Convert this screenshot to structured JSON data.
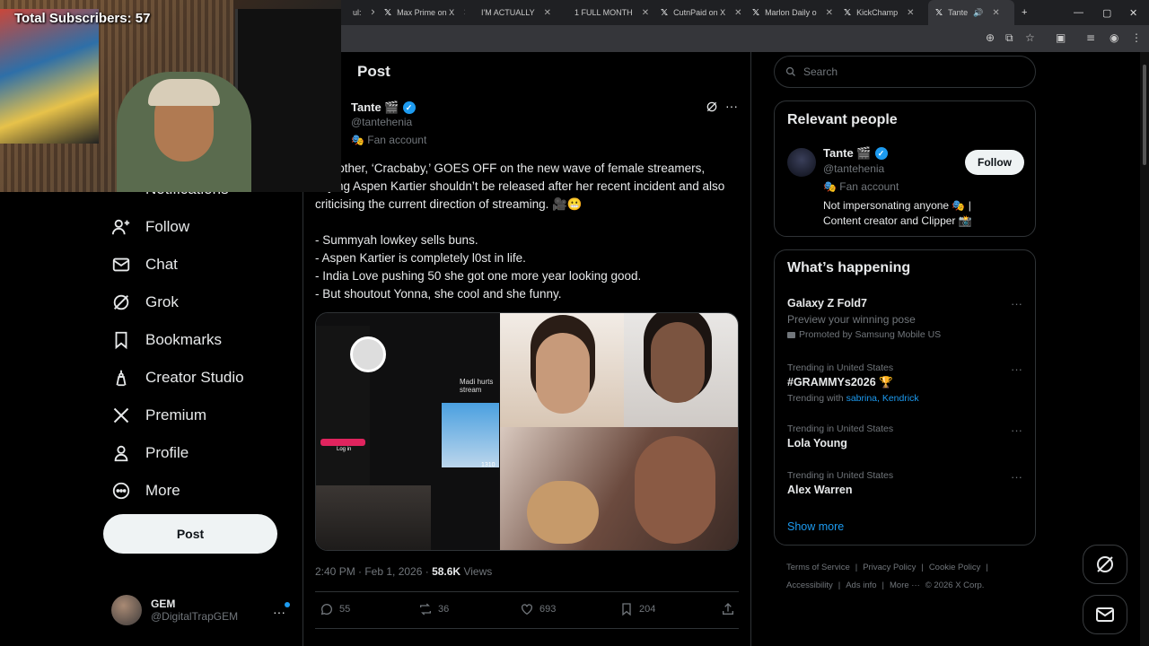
{
  "browser": {
    "tabs": [
      {
        "label": "ul:",
        "icon": "x-icon",
        "active": false
      },
      {
        "label": "Max Prime on X",
        "icon": "x-icon",
        "active": false
      },
      {
        "label": "I'M ACTUALLY",
        "icon": "youtube-icon",
        "active": false
      },
      {
        "label": "1 FULL MONTH",
        "icon": "youtube-icon",
        "active": false
      },
      {
        "label": "CutnPaid on X",
        "icon": "x-icon",
        "active": false
      },
      {
        "label": "Marlon Daily o",
        "icon": "x-icon",
        "active": false
      },
      {
        "label": "KickChamp",
        "icon": "x-icon",
        "active": false
      },
      {
        "label": "Tante",
        "icon": "x-icon",
        "active": true
      }
    ],
    "new_tab": "+"
  },
  "overlay": {
    "subscribers_label": "Total Subscribers: 57"
  },
  "nav": {
    "partial_item": "Notifications",
    "items": [
      {
        "label": "Follow",
        "icon": "follow-icon"
      },
      {
        "label": "Chat",
        "icon": "chat-icon"
      },
      {
        "label": "Grok",
        "icon": "grok-icon"
      },
      {
        "label": "Bookmarks",
        "icon": "bookmark-icon"
      },
      {
        "label": "Creator Studio",
        "icon": "creator-studio-icon"
      },
      {
        "label": "Premium",
        "icon": "x-premium-icon"
      },
      {
        "label": "Profile",
        "icon": "profile-icon"
      },
      {
        "label": "More",
        "icon": "more-circle-icon"
      }
    ],
    "post_button": "Post",
    "account": {
      "name": "GEM",
      "handle": "@DigitalTrapGEM",
      "menu": "···"
    }
  },
  "post": {
    "header": "Post",
    "author": {
      "name": "Tante 🎬",
      "handle": "@tantehenia",
      "badge": "🎭 Fan account"
    },
    "text": "’s brother, ‘Cracbaby,’ GOES OFF on the new wave of female streamers, saying Aspen Kartier shouldn’t be released after her recent incident and also criticising the current direction of streaming. 🎥😬",
    "lines": [
      "- Summyah lowkey sells buns.",
      "- Aspen Kartier is completely l0st in life.",
      "- India Love pushing 50 she got one more year looking good.",
      "- But shoutout Yonna, she cool and she funny."
    ],
    "media_caption": "Madi hurts stream",
    "media_counter": "1310",
    "media_login": "Log in",
    "time": "2:40 PM · Feb 1, 2026 · ",
    "views_count": "58.6K",
    "views_label": " Views",
    "actions": {
      "replies": "55",
      "reposts": "36",
      "likes": "693",
      "bookmarks": "204"
    }
  },
  "right": {
    "search_placeholder": "Search",
    "relevant": {
      "title": "Relevant people",
      "name": "Tante 🎬",
      "handle": "@tantehenia",
      "badge": "🎭 Fan account",
      "bio": "Not impersonating anyone 🎭 | Content creator and Clipper 📸",
      "follow": "Follow"
    },
    "happening": {
      "title": "What’s happening",
      "promo": {
        "title": "Galaxy Z Fold7",
        "sub": "Preview your winning pose",
        "promoted": "Promoted by Samsung Mobile US"
      },
      "trends": [
        {
          "context": "Trending in United States",
          "name": "#GRAMMYs2026 🏆",
          "with_label": "Trending with ",
          "with": "sabrina, Kendrick"
        },
        {
          "context": "Trending in United States",
          "name": "Lola Young"
        },
        {
          "context": "Trending in United States",
          "name": "Alex Warren"
        }
      ],
      "show_more": "Show more"
    },
    "footer": [
      "Terms of Service",
      "|",
      "Privacy Policy",
      "|",
      "Cookie Policy",
      "|"
    ],
    "footer2": [
      "Accessibility",
      "|",
      "Ads info",
      "|",
      "More ···",
      "© 2026 X Corp."
    ]
  },
  "colors": {
    "accent": "#1d9bf0",
    "bg": "#000000",
    "border": "#2f3336",
    "muted": "#71767b"
  }
}
